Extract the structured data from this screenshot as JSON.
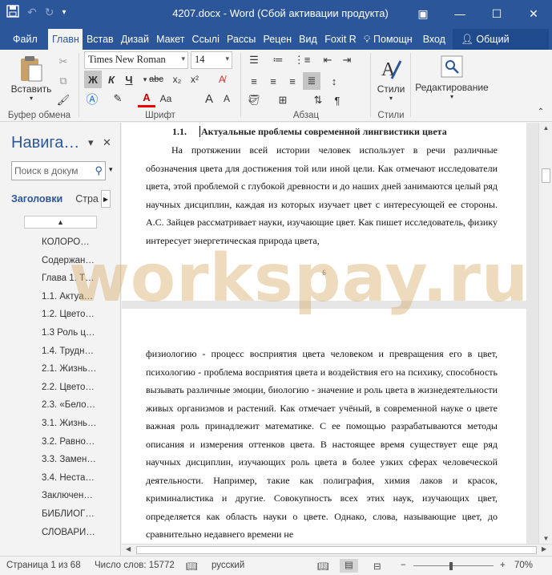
{
  "window": {
    "title": "4207.docx - Word (Сбой активации продукта)",
    "colors": {
      "accent": "#2b579a"
    }
  },
  "qat": {
    "save_icon": "save-icon",
    "undo_icon": "undo-icon",
    "redo_icon": "redo-icon"
  },
  "tabs": {
    "file": "Файл",
    "items": [
      "Главн",
      "Встав",
      "Дизай",
      "Макет",
      "Ссылі",
      "Рассы",
      "Рецен",
      "Вид",
      "Foxit R"
    ],
    "help": "Помощн",
    "signin": "Вход",
    "share": "Общий доступ"
  },
  "ribbon": {
    "clipboard": {
      "paste": "Вставить",
      "label": "Буфер обмена"
    },
    "font": {
      "name": "Times New Roman",
      "size": "14",
      "label": "Шрифт",
      "bold": "Ж",
      "italic": "К",
      "underline": "Ч"
    },
    "paragraph": {
      "label": "Абзац"
    },
    "styles": {
      "button": "Стили",
      "label": "Стили"
    },
    "editing": {
      "button": "Редактирование"
    }
  },
  "nav": {
    "title": "Навига…",
    "search_placeholder": "Поиск в докум",
    "tab_headings": "Заголовки",
    "tab_pages": "Стра",
    "headings": [
      "КОЛОРО…",
      "Содержан…",
      "Глава 1. Т…",
      "1.1. Актуа…",
      "1.2. Цвето…",
      "1.3 Роль ц…",
      "1.4. Трудн…",
      "2.1. Жизнь…",
      "2.2. Цвето…",
      "2.3. «Бело…",
      "3.1. Жизнь…",
      "3.2. Равно…",
      "3.3. Замен…",
      "3.4. Неста…",
      "Заключен…",
      "БИБЛИОГ…",
      "СЛОВАРИ…"
    ]
  },
  "document": {
    "heading_number": "1.1.",
    "heading_text": "Актуальные проблемы современной лингвистики цвета",
    "page1_paragraph": "На протяжении всей истории человек использует в речи различные обозначения цвета для достижения той или иной цели. Как отмечают исследователи цвета, этой проблемой с глубокой древности и до наших дней занимаются целый ряд научных дисциплин, каждая из которых изучает цвет с интересующей ее стороны. А.С. Зайцев рассматривает науки, изучающие цвет. Как пишет исследователь, физику интересует энергетическая природа цвета,",
    "page_number": "6",
    "page2_paragraph": "физиологию - процесс восприятия цвета человеком и превращения его в цвет, психологию - проблема восприятия цвета и воздействия его на психику, способность вызывать различные эмоции, биологию - значение и роль цвета в жизнедеятельности живых организмов и растений. Как отмечает учёный, в современной науке о цвете важная роль принадлежит математике. С ее помощью разрабатываются методы описания и измерения оттенков цвета. В настоящее время существует еще ряд научных дисциплин, изучающих роль цвета в более узких сферах человеческой деятельности. Например, такие как полиграфия, химия лаков и красок, криминалистика и другие. Совокупность всех этих наук, изучающих цвет, определяется как область науки о цвете. Однако, слова, называющие цвет, до сравнительно недавнего времени не"
  },
  "watermark": "workspay.ru",
  "status": {
    "page": "Страница 1 из 68",
    "words": "Число слов: 15772",
    "language": "русский",
    "zoom": "70%"
  }
}
